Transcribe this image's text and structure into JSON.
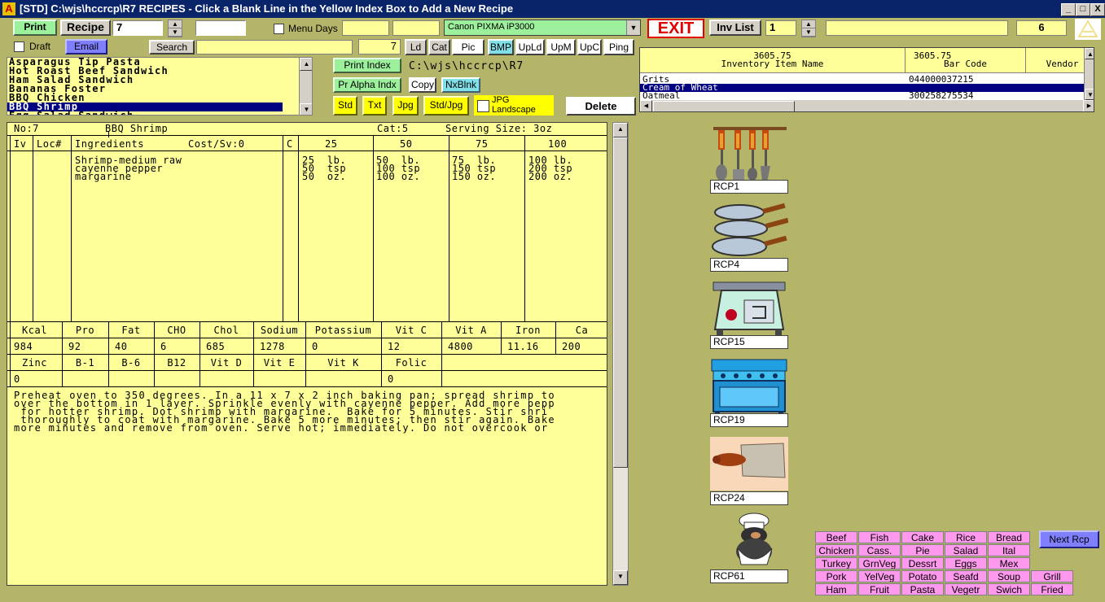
{
  "window": {
    "title": "[STD] C:\\wjs\\hccrcp\\R7   RECIPES - Click a Blank Line in the Yellow Index Box to Add a New Recipe",
    "minimize": "_",
    "maximize": "□",
    "close": "X"
  },
  "toolbar": {
    "print_label": "Print",
    "recipe_label": "Recipe",
    "recipe_number": "7",
    "menu_days_label": "Menu Days",
    "printer_name": "Canon PIXMA iP3000",
    "exit_label": "EXIT",
    "inv_list_label": "Inv List",
    "inv_list_number": "1",
    "right_number": "6",
    "draft_label": "Draft",
    "email_label": "Email",
    "search_label": "Search",
    "small_number": "7",
    "mini_buttons": [
      "Ld",
      "Cat",
      "Pic",
      "BMP",
      "UpLd",
      "UpM",
      "UpC",
      "Ping"
    ]
  },
  "recipe_list": {
    "items": [
      "Asparagus Tip Pasta",
      "Hot Roast Beef Sandwich",
      "Ham Salad Sandwich",
      "Bananas Foster",
      "BBQ Chicken",
      "BBQ Shrimp",
      "Egg Salad Sandwich"
    ],
    "selected_index": 5
  },
  "mid_controls": {
    "print_index_label": "Print Index",
    "path_text": "C:\\wjs\\hccrcp\\R7",
    "pr_alpha_label": "Pr Alpha Indx",
    "copy_label": "Copy",
    "nxblnk_label": "NxBlnk",
    "std_label": "Std",
    "txt_label": "Txt",
    "jpg_label": "Jpg",
    "stdjpg_label": "Std/Jpg",
    "jpg_landscape_label": "JPG Landscape",
    "delete_label": "Delete"
  },
  "inventory": {
    "col1_value": "3605.75",
    "col1_header": "Inventory Item Name",
    "col2_value": "3605.75",
    "col2_header": "Bar Code",
    "col3_header": "Vendor",
    "rows": [
      {
        "name": "Grits",
        "code": "044000037215"
      },
      {
        "name": "Cream of Wheat",
        "code": ""
      },
      {
        "name": "Oatmeal",
        "code": "300258275534"
      }
    ],
    "selected_index": 1
  },
  "recipe": {
    "no_label": "No:7",
    "name": "BBQ Shrimp",
    "cat_label": "Cat:5",
    "serving_label": "Serving Size: 3oz",
    "col_iv": "Iv",
    "col_loc": "Loc#",
    "col_ingredients": "Ingredients",
    "col_cost": "Cost/Sv:0",
    "col_c": "C",
    "yields": [
      "25",
      "50",
      "75",
      "100"
    ],
    "ingredients": [
      "Shrimp-medium raw",
      "cayenne pepper",
      "margarine"
    ],
    "quantities": [
      [
        "25  lb.",
        "50  tsp",
        "50  oz."
      ],
      [
        "50  lb.",
        "100 tsp",
        "100 oz."
      ],
      [
        "75  lb.",
        "150 tsp",
        "150 oz."
      ],
      [
        "100 lb.",
        "200 tsp",
        "200 oz."
      ]
    ],
    "nutrition_headers_1": [
      "Kcal",
      "Pro",
      "Fat",
      "CHO",
      "Chol",
      "Sodium",
      "Potassium",
      "Vit C",
      "Vit A",
      "Iron",
      "Ca"
    ],
    "nutrition_values_1": [
      "984",
      "92",
      "40",
      "6",
      "685",
      "1278",
      "0",
      "12",
      "4800",
      "11.16",
      "200"
    ],
    "nutrition_headers_2": [
      "Zinc",
      "B-1",
      "B-6",
      "B12",
      "Vit D",
      "Vit E",
      "Vit K",
      "Folic"
    ],
    "nutrition_values_2": [
      "0",
      "",
      "",
      "",
      "",
      "",
      "",
      "0"
    ],
    "directions": [
      "Preheat oven to 350 degrees. In a 11 x 7 x 2 inch baking pan; spread shrimp to",
      "over the bottom in 1 layer. Sprinkle evenly with cayenne pepper. Add more pepp",
      " for hotter shrimp. Dot shrimp with margarine.  Bake for 5 minutes. Stir shri",
      " thoroughly to coat with margarine. Bake 5 more minutes; then stir again. Bake",
      "more minutes and remove from oven. Serve hot; immediately. Do not overcook or"
    ]
  },
  "pictures": [
    {
      "label": "RCP1",
      "icon": "utensils-icon"
    },
    {
      "label": "RCP4",
      "icon": "frying-pans-icon"
    },
    {
      "label": "RCP15",
      "icon": "kitchen-scale-icon"
    },
    {
      "label": "RCP19",
      "icon": "stove-icon"
    },
    {
      "label": "RCP24",
      "icon": "cleaver-icon"
    },
    {
      "label": "RCP61",
      "icon": "chef-icon"
    }
  ],
  "categories": {
    "row1": [
      "Beef",
      "Fish",
      "Cake",
      "Rice",
      "Bread"
    ],
    "row2": [
      "Chicken",
      "Cass.",
      "Pie",
      "Salad",
      "Ital"
    ],
    "row3": [
      "Turkey",
      "GrnVeg",
      "Dessrt",
      "Eggs",
      "Mex"
    ],
    "row4": [
      "Pork",
      "YelVeg",
      "Potato",
      "Seafd",
      "Soup",
      "Grill"
    ],
    "row5": [
      "Ham",
      "Fruit",
      "Pasta",
      "Vegetr",
      "Swich",
      "Fried"
    ],
    "next_label": "Next Rcp"
  },
  "colors": {
    "background": "#b5b56a",
    "sheet": "#ffff99",
    "selection": "#000080",
    "category_pink": "#ff99ee"
  }
}
